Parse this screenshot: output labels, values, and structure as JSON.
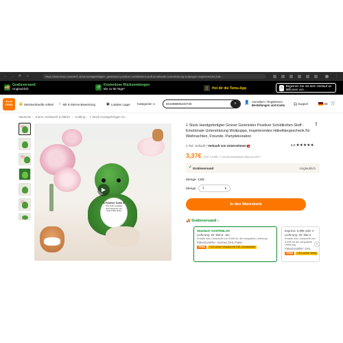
{
  "browser": {
    "url": "https://www.temu.com/de/1-stück-handgefertigter--gestrickter-positiver-schildkröten-stoff-emotionale-unterstützung-wollpuppe-inspirierendes-häk..."
  },
  "promo": {
    "items": [
      {
        "title": "Gratisversand",
        "sub": "Unglaublich",
        "icon": "truck-icon"
      },
      {
        "title": "Kostenlose Rücksendungen",
        "sub": "Bis zu 90 Tage*",
        "icon": "return-icon"
      },
      {
        "title": "Hol dir die Temu-App",
        "sub": "",
        "icon": "phone-icon"
      }
    ],
    "seller_button": "Beginnen Sie mit dem Verkauf an Millionen von ..."
  },
  "header": {
    "logo_text": "TEMU",
    "nav": [
      {
        "label": "Meistverkaufte Artikel",
        "icon": "thumbs-up-icon"
      },
      {
        "label": "Mit 5-Sterne-Bewertung",
        "icon": "star-icon"
      },
      {
        "label": "Lokales Lager",
        "icon": "warehouse-icon"
      },
      {
        "label": "Kategorien",
        "icon": "chevron-down-icon"
      }
    ],
    "search_value": "601098805240730",
    "account_line1": "Anmelden / Registrieren",
    "account_line2": "Bestellungen und Konto",
    "support": "Support",
    "lang": "DE",
    "colors": {
      "accent": "#fb7701",
      "green": "#0a8a2c"
    }
  },
  "breadcrumb": [
    "Startseite",
    "Kunst, Handwerk & Nähen",
    "Crafting",
    "1 Stück Handgefertigter Gr..."
  ],
  "product": {
    "image_text": "A Positive Turtle &",
    "image_card": "This turtle is always here whenever you need a little cheer",
    "title": "1 Stück Handgefertigter Grüner Gestrickter Positiver Schildkröten-Stoff - Emotionale Unterstützung Wollpuppe, Inspirierendes Häkelitiergeschenk für Weihnachten, Freunde, Partydekoration",
    "sold": "4 Tsd. verkauft",
    "sold_by": "Verkauft von Unternehmen",
    "rating": "5,0",
    "stars": "★★★★★",
    "price": "3,37€",
    "price_note": "UVP 13,35€  ⓘ  mit Mehrwertsteuer  Was ist UVP?",
    "free_shipping": "Gratisversand",
    "free_shipping_right": "Unglaublich",
    "color_label": "Menge: 1Stk",
    "qty_label": "Menge",
    "qty_value": "1",
    "cart_button": "In den Warenkorb"
  },
  "shipping": {
    "title": "Gratisversand",
    "standard": {
      "line1": "Standard: KOSTENLOS",
      "line2": "Lieferung: 30. Mai-5. Jun.",
      "line3": "Erhalte eine Gutschrift von 5,00€ für die verspätete Lieferung",
      "line4": "Paketzusteller: Hermes  DHL Paket",
      "tag": "TEMU",
      "tag2": "CO2-armer Versand mit DHL Deutschland"
    },
    "express": {
      "line1": "Express: 6,99€ oder 4",
      "line2": "Lieferung: 30. Mai-4",
      "line3": "Erhalte eine Gutschrift von 5,00€ für die verspätete Lieferung",
      "line4": "Paketzusteller: DHL",
      "tag": "TEMU",
      "tag2": "CO2-armer Versa"
    }
  }
}
